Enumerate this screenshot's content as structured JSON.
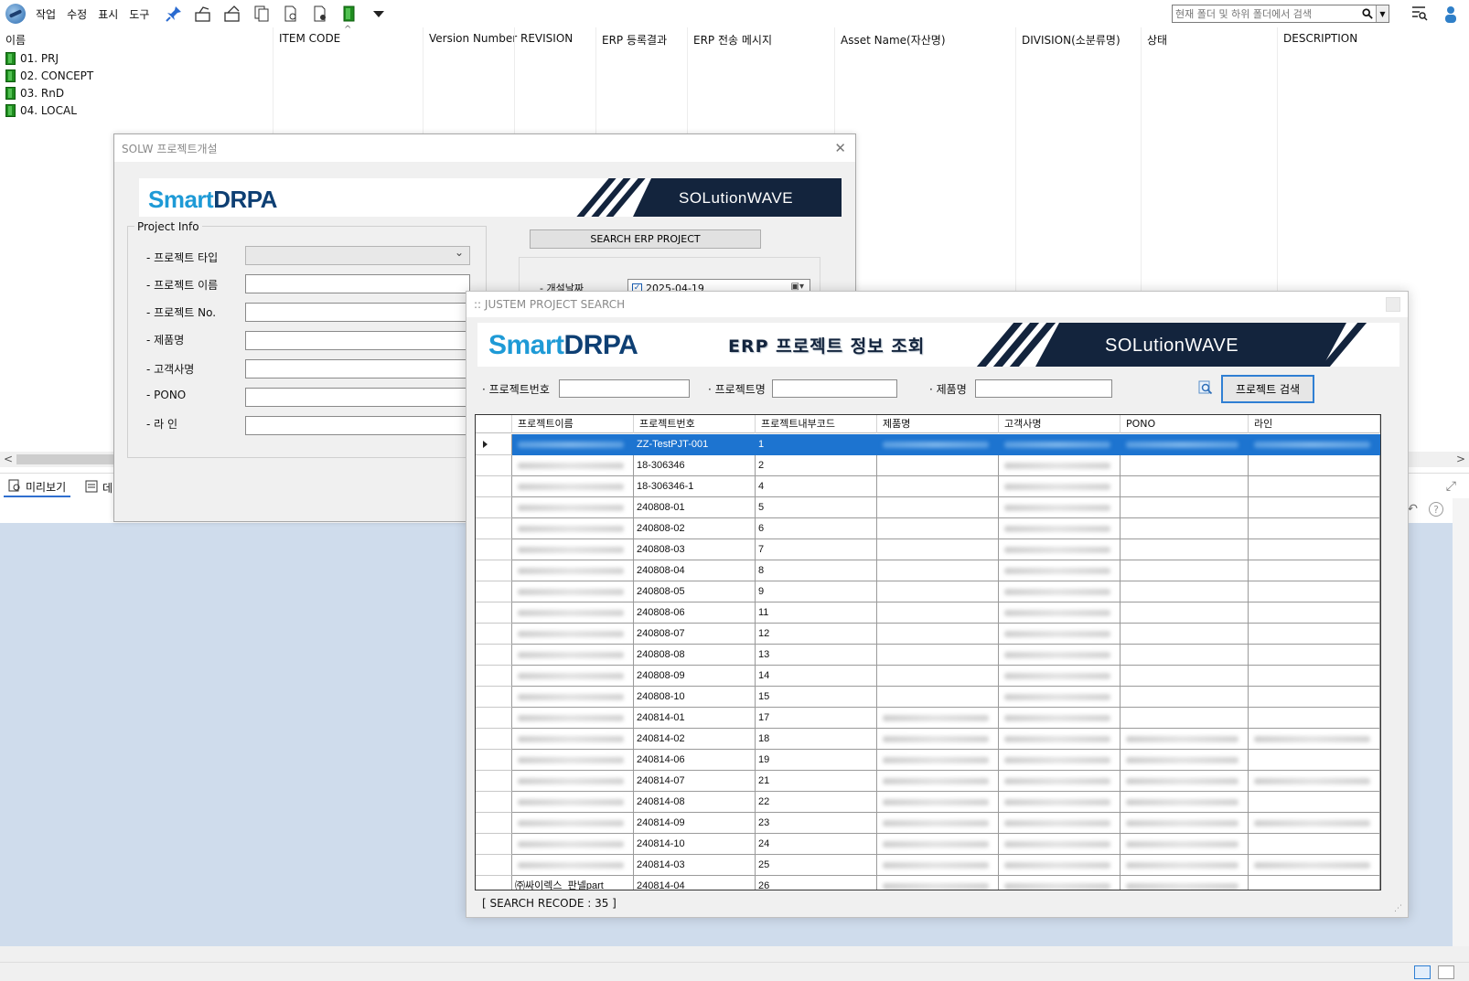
{
  "menu": [
    "작업",
    "수정",
    "표시",
    "도구"
  ],
  "toolbar_icons": [
    "pin-icon",
    "checkin-icon",
    "checkout-icon",
    "copy-doc-icon",
    "doc-search-icon",
    "doc-lock-icon",
    "green-folder-icon",
    "dropdown-arrow-icon"
  ],
  "search": {
    "placeholder": "현재 폴더 및 하위 폴더에서 검색"
  },
  "columns": [
    "이름",
    "ITEM CODE",
    "Version Number",
    "REVISION",
    "ERP 등록결과",
    "ERP 전송 메시지",
    "Asset Name(자산명)",
    "DIVISION(소분류명)",
    "상태",
    "DESCRIPTION"
  ],
  "tree": [
    "01. PRJ",
    "02. CONCEPT",
    "03. RnD",
    "04. LOCAL"
  ],
  "bottom_tabs": {
    "preview": "미리보기",
    "data": "데"
  },
  "solw": {
    "title": "SOLW 프로젝트개설",
    "group_title": "Project Info",
    "labels": [
      "- 프로젝트 타입",
      "- 프로젝트 이름",
      "- 프로젝트 No.",
      "- 제품명",
      "- 고객사명",
      "- PONO",
      "- 라 인"
    ],
    "search_btn": "SEARCH ERP PROJECT",
    "date_label": "- 개설날짜",
    "date_value": "2025-04-19"
  },
  "brand": {
    "smart": "Smart",
    "drpa": "DRPA",
    "wave": "SOLutionWAVE"
  },
  "justem": {
    "title": ":: JUSTEM PROJECT SEARCH",
    "banner_title": "ERP 프로젝트 정보 조회",
    "filters": [
      "· 프로젝트번호",
      "· 프로젝트명",
      "· 제품명"
    ],
    "search_btn": "프로젝트 검색",
    "headers": [
      "프로젝트이름",
      "프로젝트번호",
      "프로젝트내부코드",
      "제품명",
      "고객사명",
      "PONO",
      "라인"
    ],
    "rows": [
      {
        "name": "",
        "no": "ZZ-TestPJT-001",
        "code": "1"
      },
      {
        "name": "",
        "no": "18-306346",
        "code": "2"
      },
      {
        "name": "",
        "no": "18-306346-1",
        "code": "4"
      },
      {
        "name": "",
        "no": "240808-01",
        "code": "5"
      },
      {
        "name": "",
        "no": "240808-02",
        "code": "6"
      },
      {
        "name": "",
        "no": "240808-03",
        "code": "7"
      },
      {
        "name": "",
        "no": "240808-04",
        "code": "8"
      },
      {
        "name": "",
        "no": "240808-05",
        "code": "9"
      },
      {
        "name": "",
        "no": "240808-06",
        "code": "11"
      },
      {
        "name": "",
        "no": "240808-07",
        "code": "12"
      },
      {
        "name": "",
        "no": "240808-08",
        "code": "13"
      },
      {
        "name": "",
        "no": "240808-09",
        "code": "14"
      },
      {
        "name": "",
        "no": "240808-10",
        "code": "15"
      },
      {
        "name": "",
        "no": "240814-01",
        "code": "17"
      },
      {
        "name": "",
        "no": "240814-02",
        "code": "18"
      },
      {
        "name": "",
        "no": "240814-06",
        "code": "19"
      },
      {
        "name": "",
        "no": "240814-07",
        "code": "21"
      },
      {
        "name": "",
        "no": "240814-08",
        "code": "22"
      },
      {
        "name": "",
        "no": "240814-09",
        "code": "23"
      },
      {
        "name": "",
        "no": "240814-10",
        "code": "24"
      },
      {
        "name": "",
        "no": "240814-03",
        "code": "25"
      },
      {
        "name": "㈜싸이렉스_판넬part",
        "no": "240814-04",
        "code": "26"
      }
    ],
    "status": "[ SEARCH RECODE : 35 ]"
  }
}
